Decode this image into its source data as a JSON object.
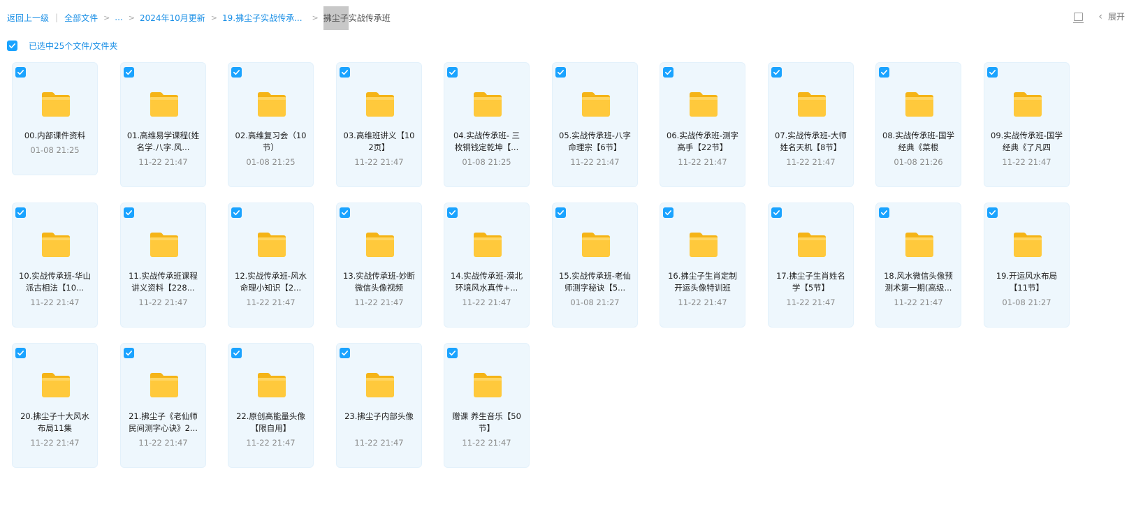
{
  "breadcrumb": {
    "back": "返回上一级",
    "all_files": "全部文件",
    "ellipsis": "...",
    "update": "2024年10月更新",
    "parent": "19.拂尘子实战传承...",
    "current_highlight": "拂尘子",
    "current_rest": "实战传承班"
  },
  "toolbar": {
    "expand": "展开"
  },
  "selection": {
    "label": "已选中25个文件/文件夹"
  },
  "colors": {
    "accent": "#1a8fe6",
    "checkbox": "#1aa3ff",
    "tile_bg": "#eef7fd",
    "folder": "#ffc83a"
  },
  "files": [
    {
      "name": "00.内部课件资料",
      "date": "01-08 21:25"
    },
    {
      "name": "01.高维易学课程(姓名学.八字.风...",
      "date": "11-22 21:47"
    },
    {
      "name": "02.高维复习会（10节）",
      "date": "01-08 21:25"
    },
    {
      "name": "03.高维班讲义【102页】",
      "date": "11-22 21:47"
    },
    {
      "name": "04.实战传承班- 三枚铜钱定乾坤【...",
      "date": "01-08 21:25"
    },
    {
      "name": "05.实战传承班-八字命理宗【6节】",
      "date": "11-22 21:47"
    },
    {
      "name": "06.实战传承班-测字高手【22节】",
      "date": "11-22 21:47"
    },
    {
      "name": "07.实战传承班-大师姓名天机【8节】",
      "date": "11-22 21:47"
    },
    {
      "name": "08.实战传承班-国学经典《菜根",
      "date": "01-08 21:26"
    },
    {
      "name": "09.实战传承班-国学经典《了凡四",
      "date": "11-22 21:47"
    },
    {
      "name": "10.实战传承班-华山派古相法【10...",
      "date": "11-22 21:47"
    },
    {
      "name": "11.实战传承班课程讲义资料【228...",
      "date": "11-22 21:47"
    },
    {
      "name": "12.实战传承班-风水命理小知识【2...",
      "date": "11-22 21:47"
    },
    {
      "name": "13.实战传承班-妙断微信头像视频",
      "date": "11-22 21:47"
    },
    {
      "name": "14.实战传承班-漠北环境风水真传+...",
      "date": "11-22 21:47"
    },
    {
      "name": "15.实战传承班-老仙师测字秘诀【5...",
      "date": "01-08 21:27"
    },
    {
      "name": "16.拂尘子生肖定制开运头像特训班",
      "date": "11-22 21:47"
    },
    {
      "name": "17.拂尘子生肖姓名学【5节】",
      "date": "11-22 21:47"
    },
    {
      "name": "18.风水微信头像预测术第一期(高级...",
      "date": "11-22 21:47"
    },
    {
      "name": "19.开运风水布局【11节】",
      "date": "01-08 21:27"
    },
    {
      "name": "20.拂尘子十大风水布局11集",
      "date": "11-22 21:47"
    },
    {
      "name": "21.拂尘子《老仙师民间测字心诀》2...",
      "date": "11-22 21:47"
    },
    {
      "name": "22.原创高能量头像【限自用】",
      "date": "11-22 21:47"
    },
    {
      "name": "23.拂尘子内部头像",
      "date": "11-22 21:47"
    },
    {
      "name": "赠课 养生音乐【50节】",
      "date": "11-22 21:47"
    }
  ]
}
